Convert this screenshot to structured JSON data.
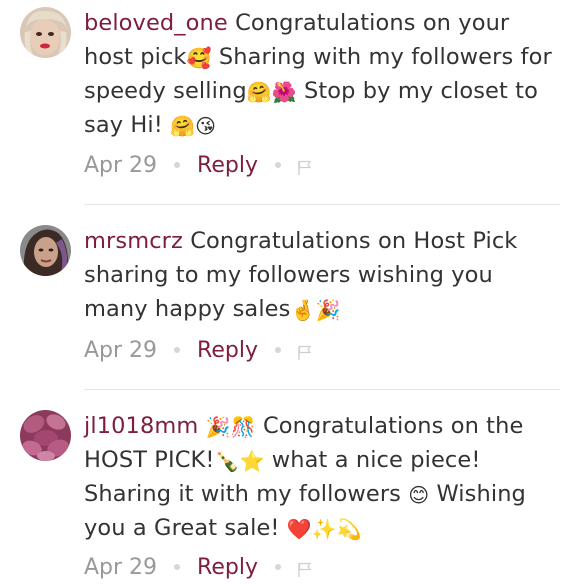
{
  "comments": [
    {
      "username": "beloved_one",
      "text_parts": [
        " Congratulations on your host pick",
        " Sharing with my followers for speedy selling",
        " Stop by my closet to say Hi! "
      ],
      "emoji": [
        "🥰",
        "🤗",
        "🌺",
        "🤗",
        "😘"
      ],
      "date": "Apr 29",
      "reply_label": "Reply"
    },
    {
      "username": "mrsmcrz",
      "text_parts": [
        " Congratulations on Host Pick sharing to my followers wishing you many happy sales"
      ],
      "emoji": [
        "🤞",
        "🎉"
      ],
      "date": "Apr 29",
      "reply_label": "Reply"
    },
    {
      "username": "jl1018mm",
      "text_parts": [
        " Congratulations on the HOST PICK!",
        " what a nice piece! Sharing it with my followers ",
        " Wishing you a Great sale! "
      ],
      "emoji": [
        "🎉",
        "🎊",
        "🍾",
        "⭐",
        "😊",
        "❤️",
        "✨",
        "💫"
      ],
      "date": "Apr 29",
      "reply_label": "Reply"
    }
  ],
  "colors": {
    "username": "#7f1e3c",
    "reply": "#7f1e3c",
    "body_text": "#333333",
    "meta_text": "#999999",
    "divider": "#e6e6e6"
  },
  "icons": {
    "flag": "flag-icon",
    "separator": "dot-separator"
  }
}
